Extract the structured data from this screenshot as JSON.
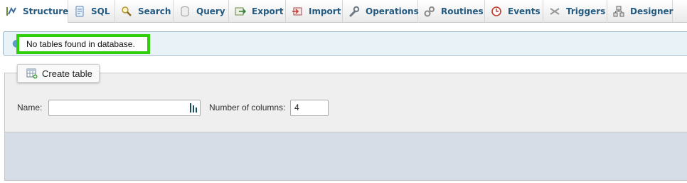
{
  "tabs": [
    {
      "label": "Structure",
      "icon": "structure-icon",
      "active": true
    },
    {
      "label": "SQL",
      "icon": "sql-icon"
    },
    {
      "label": "Search",
      "icon": "search-icon"
    },
    {
      "label": "Query",
      "icon": "query-icon"
    },
    {
      "label": "Export",
      "icon": "export-icon"
    },
    {
      "label": "Import",
      "icon": "import-icon"
    },
    {
      "label": "Operations",
      "icon": "wrench-icon"
    },
    {
      "label": "Routines",
      "icon": "routines-icon"
    },
    {
      "label": "Events",
      "icon": "clock-icon"
    },
    {
      "label": "Triggers",
      "icon": "triggers-icon"
    },
    {
      "label": "Designer",
      "icon": "designer-icon"
    }
  ],
  "notice": {
    "text": "No tables found in database."
  },
  "create_table": {
    "legend_label": "Create table",
    "name_label": "Name:",
    "name_value": "",
    "columns_label": "Number of columns:",
    "columns_value": "4"
  },
  "colors": {
    "tab_text": "#235a81",
    "highlight_border": "#2fd00b",
    "notice_bg": "#e9f2f7",
    "panel_bg": "#efefef",
    "panel_footer_bg": "#d7dde6"
  }
}
